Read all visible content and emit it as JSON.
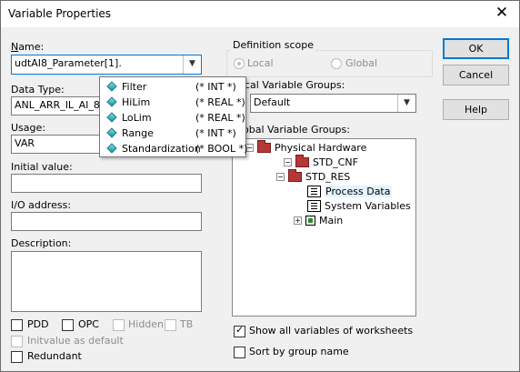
{
  "window": {
    "title": "Variable Properties",
    "close_glyph": "✕"
  },
  "left": {
    "name_label": "Name:",
    "name_value": "udtAI8_Parameter[1].",
    "data_type_label": "Data Type:",
    "data_type_value": "ANL_ARR_IL_AI_8",
    "usage_label": "Usage:",
    "usage_value": "VAR",
    "initial_value_label": "Initial value:",
    "initial_value": "",
    "io_address_label": "I/O address:",
    "io_address_value": "",
    "description_label": "Description:",
    "description_value": "",
    "checks": {
      "pdd": {
        "label": "PDD",
        "checked": false,
        "enabled": true
      },
      "opc": {
        "label": "OPC",
        "checked": false,
        "enabled": true
      },
      "hidden": {
        "label": "Hidden",
        "checked": false,
        "enabled": false
      },
      "tb": {
        "label": "TB",
        "checked": false,
        "enabled": false
      },
      "initvalue_default": {
        "label": "Initvalue as default",
        "checked": false,
        "enabled": false
      },
      "redundant": {
        "label": "Redundant",
        "checked": false,
        "enabled": true
      }
    }
  },
  "autocomplete": {
    "items": [
      {
        "name": "Filter",
        "type": "(* INT *)"
      },
      {
        "name": "HiLim",
        "type": "(* REAL *)"
      },
      {
        "name": "LoLim",
        "type": "(* REAL *)"
      },
      {
        "name": "Range",
        "type": "(* INT *)"
      },
      {
        "name": "Standardization",
        "type": "(* BOOL *)"
      }
    ]
  },
  "scope": {
    "label": "Definition scope",
    "local_label": "Local",
    "global_label": "Global",
    "selected": "local",
    "local_groups_label": "cal Variable Groups:",
    "local_groups_value": "Default",
    "global_groups_label": "obal Variable Groups:"
  },
  "tree": [
    {
      "label": "Physical Hardware",
      "icon": "folder-icon",
      "expander": "-"
    },
    {
      "label": "STD_CNF",
      "icon": "folder-icon",
      "expander": "-"
    },
    {
      "label": "STD_RES",
      "icon": "folder-icon",
      "expander": "-"
    },
    {
      "label": "Process Data",
      "icon": "variable-group-icon",
      "expander": "",
      "selected": true
    },
    {
      "label": "System Variables",
      "icon": "variable-group-icon",
      "expander": ""
    },
    {
      "label": "Main",
      "icon": "program-icon",
      "expander": "+"
    }
  ],
  "bottom_right": {
    "show_all": {
      "label": "Show all variables of worksheets",
      "checked": true
    },
    "sort_group": {
      "label": "Sort by group name",
      "checked": false
    }
  },
  "buttons": {
    "ok": "OK",
    "cancel": "Cancel",
    "help": "Help"
  },
  "colors": {
    "focus": "#0078d7",
    "folder": "#b53838",
    "popup_icon": "#1a8fa8"
  }
}
